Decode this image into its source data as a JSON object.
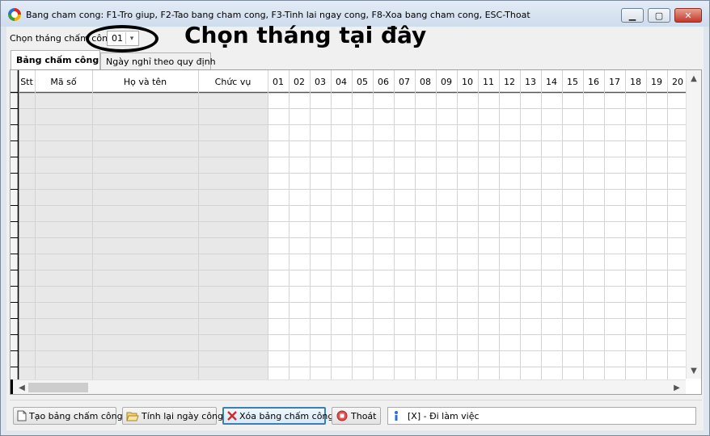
{
  "window": {
    "title": "Bang cham cong: F1-Tro giup, F2-Tao bang cham cong, F3-Tinh lai ngay cong, F8-Xoa bang cham cong, ESC-Thoat",
    "icons": {
      "app": "app-logo-icon",
      "minimize": "minimize-icon",
      "maximize": "maximize-icon",
      "close": "close-icon"
    }
  },
  "month_picker": {
    "label": "Chọn tháng chấm công:",
    "selected": "01"
  },
  "annotation": {
    "text": "Chọn tháng tại đây"
  },
  "tabs": [
    {
      "label": "Bảng chấm công",
      "active": true
    },
    {
      "label": "Ngày nghỉ theo quy định",
      "active": false
    }
  ],
  "grid": {
    "columns": [
      "Stt",
      "Mã số",
      "Họ và tên",
      "Chức vụ",
      "01",
      "02",
      "03",
      "04",
      "05",
      "06",
      "07",
      "08",
      "09",
      "10",
      "11",
      "12",
      "13",
      "14",
      "15",
      "16",
      "17",
      "18",
      "19",
      "20"
    ],
    "row_count": 18
  },
  "buttons": {
    "create": "Tạo bảng chấm công",
    "recalc": "Tính lại ngày công",
    "delete": "Xóa bảng chấm công",
    "exit": "Thoát"
  },
  "status": {
    "text": "[X] - Đi làm việc"
  },
  "colors": {
    "window_bg": "#dfe6ee",
    "client_bg": "#f0f0f0",
    "shaded_column": "#e8e8e8",
    "delete_border": "#3c7fb1"
  }
}
